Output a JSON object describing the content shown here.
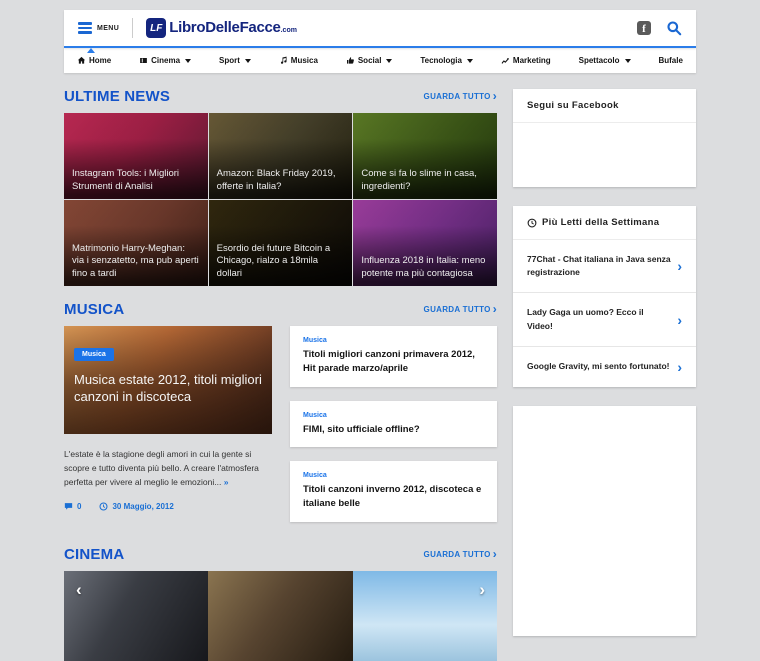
{
  "header": {
    "menu_label": "MENU",
    "logo": {
      "icon_text": "LF",
      "name": "LibroDelleFacce",
      "tld": ".com"
    },
    "facebook_glyph": "f"
  },
  "nav": [
    {
      "label": "Home"
    },
    {
      "label": "Cinema"
    },
    {
      "label": "Sport"
    },
    {
      "label": "Musica"
    },
    {
      "label": "Social"
    },
    {
      "label": "Tecnologia"
    },
    {
      "label": "Marketing"
    },
    {
      "label": "Spettacolo"
    },
    {
      "label": "Bufale"
    }
  ],
  "news": {
    "title": "ULTIME NEWS",
    "see_all": "GUARDA TUTTO",
    "cards": [
      {
        "title": "Instagram Tools: i Migliori Strumenti di Analisi"
      },
      {
        "title": "Amazon: Black Friday 2019, offerte in Italia?"
      },
      {
        "title": "Come si fa lo slime in casa, ingredienti?"
      },
      {
        "title": "Matrimonio Harry-Meghan: via i senzatetto, ma pub aperti fino a tardi"
      },
      {
        "title": "Esordio dei future Bitcoin a Chicago, rialzo a 18mila dollari"
      },
      {
        "title": "Influenza 2018 in Italia: meno potente ma più contagiosa"
      }
    ]
  },
  "musica": {
    "title": "MUSICA",
    "see_all": "GUARDA TUTTO",
    "featured": {
      "category": "Musica",
      "title": "Musica estate 2012, titoli migliori canzoni in discoteca",
      "excerpt": "L'estate è la stagione degli amori in cui la gente si scopre e tutto diventa più bello. A creare l'atmosfera perfetta per vivere al meglio le emozioni...",
      "read_more": "»",
      "comments": "0",
      "date": "30 Maggio, 2012"
    },
    "list": [
      {
        "category": "Musica",
        "title": "Titoli migliori canzoni primavera 2012, Hit parade marzo/aprile"
      },
      {
        "category": "Musica",
        "title": "FIMI, sito ufficiale offline?"
      },
      {
        "category": "Musica",
        "title": "Titoli canzoni inverno 2012, discoteca e italiane belle"
      }
    ]
  },
  "cinema": {
    "title": "CINEMA",
    "see_all": "GUARDA TUTTO"
  },
  "sidebar": {
    "facebook_box": {
      "title": "Segui su Facebook"
    },
    "top_week": {
      "title": "Più Letti della Settimana",
      "items": [
        "77Chat - Chat italiana in Java senza registrazione",
        "Lady Gaga un uomo? Ecco il Video!",
        "Google Gravity, mi sento fortunato!"
      ]
    }
  },
  "ui": {
    "chevron": "›",
    "prev_arrow": "‹",
    "next_arrow": "›"
  },
  "colors": {
    "accent_blue": "#1a6fd4",
    "heading_blue": "#1353c9",
    "logo_navy": "#14257e",
    "badge_blue": "#1a73e8",
    "page_bg": "#dcdddf"
  }
}
